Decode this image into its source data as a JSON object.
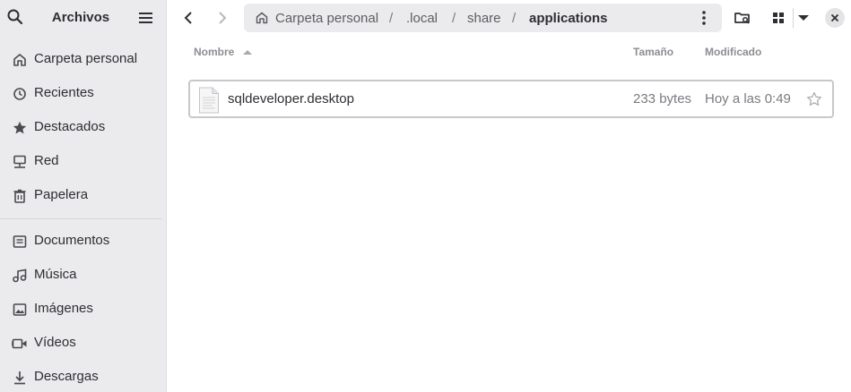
{
  "sidebar": {
    "title": "Archivos",
    "items": [
      {
        "label": "Carpeta personal",
        "icon": "home-icon"
      },
      {
        "label": "Recientes",
        "icon": "clock-icon"
      },
      {
        "label": "Destacados",
        "icon": "star-icon"
      },
      {
        "label": "Red",
        "icon": "network-icon"
      },
      {
        "label": "Papelera",
        "icon": "trash-icon"
      },
      {
        "label": "Documentos",
        "icon": "document-icon"
      },
      {
        "label": "Música",
        "icon": "music-icon"
      },
      {
        "label": "Imágenes",
        "icon": "image-icon"
      },
      {
        "label": "Vídeos",
        "icon": "video-icon"
      },
      {
        "label": "Descargas",
        "icon": "download-icon"
      }
    ]
  },
  "pathbar": {
    "crumbs": [
      "Carpeta personal",
      ".local",
      "share",
      "applications"
    ],
    "separator": "/"
  },
  "columns": {
    "name": "Nombre",
    "size": "Tamaño",
    "modified": "Modificado"
  },
  "files": [
    {
      "name": "sqldeveloper.desktop",
      "size": "233 bytes",
      "modified": "Hoy a las 0:49",
      "starred": false
    }
  ],
  "colors": {
    "sidebar_bg": "#ebebed",
    "text": "#2e2e33",
    "muted": "#7a7a80"
  }
}
